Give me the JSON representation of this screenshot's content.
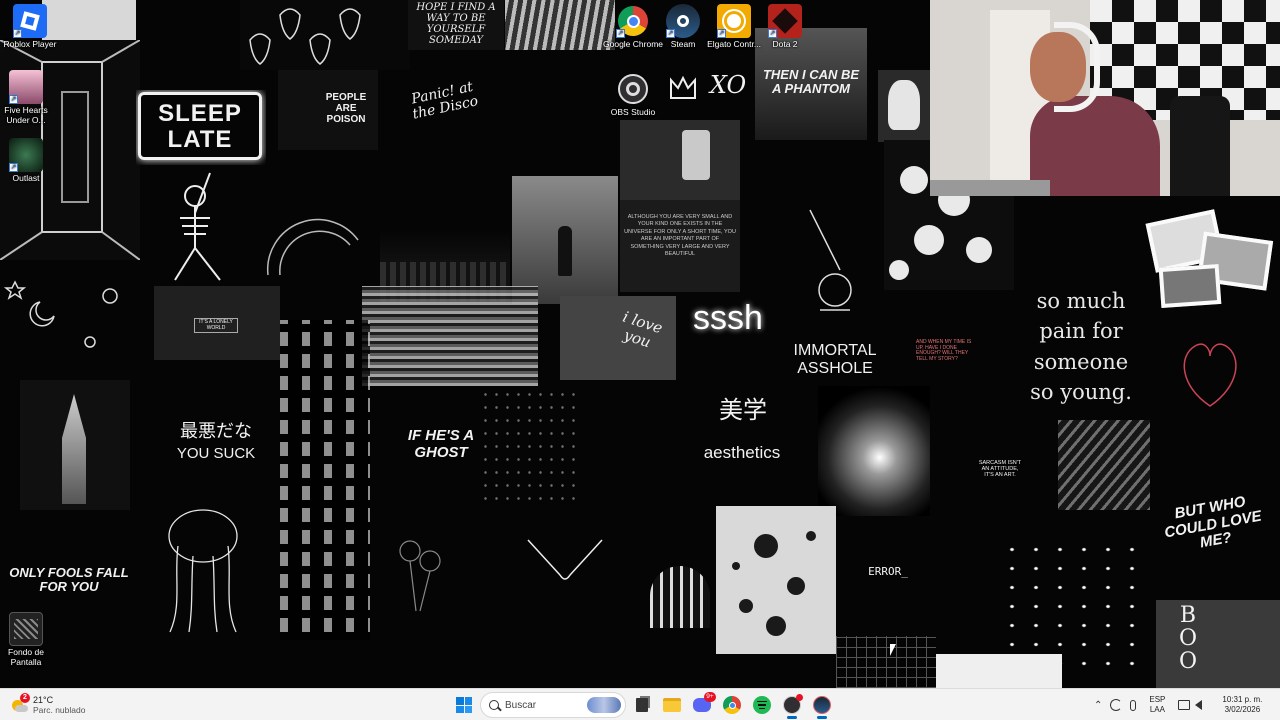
{
  "desktop_icons_left": [
    {
      "name": "roblox-player-shortcut",
      "label": "Roblox Player",
      "icon": "roblox-icon"
    },
    {
      "name": "five-hearts-shortcut",
      "label": "Five Hearts Under O...",
      "icon": "five-hearts-icon"
    },
    {
      "name": "outlast-shortcut",
      "label": "Outlast",
      "icon": "outlast-icon"
    },
    {
      "name": "fondo-de-pantalla-shortcut",
      "label": "Fondo de Pantalla",
      "icon": "wallpaper-icon"
    }
  ],
  "desktop_icons_top": [
    {
      "name": "google-chrome-shortcut",
      "label": "Google Chrome",
      "icon": "chrome-icon"
    },
    {
      "name": "steam-shortcut",
      "label": "Steam",
      "icon": "steam-icon"
    },
    {
      "name": "elgato-shortcut",
      "label": "Elgato Contr...",
      "icon": "elgato-icon"
    },
    {
      "name": "dota2-shortcut",
      "label": "Dota 2",
      "icon": "dota2-icon"
    },
    {
      "name": "obs-studio-shortcut",
      "label": "OBS Studio",
      "icon": "obs-icon"
    }
  ],
  "wallpaper_texts": {
    "sleep_late": "SLEEP LATE",
    "people_poison": "PEOPLE ARE POISON",
    "panic_disco": "Panic! at the Disco",
    "hope": "HOPE I FIND A WAY TO BE YOURSELF SOMEDAY",
    "phantom": "THEN I CAN BE A PHANTOM",
    "sssh": "sssh",
    "i_love_you": "i love you",
    "immortal": "IMMORTAL ASSHOLE",
    "so_much_pain": "so much pain for someone so young.",
    "japanese_suck": "最悪だな",
    "you_suck": "YOU SUCK",
    "ghost": "IF HE'S A GHOST",
    "aesthetics_jp": "美学",
    "aesthetics": "aesthetics",
    "only_fools": "ONLY FOOLS FALL FOR YOU",
    "but_who": "BUT WHO COULD LOVE ME?",
    "error": "ERROR_",
    "sarcasm": "SARCASM ISN'T AN ATTITUDE, IT'S AN ART.",
    "boo": "BOO",
    "xo": "XO",
    "small_note": "ALTHOUGH YOU ARE VERY SMALL AND YOUR KIND ONE EXISTS IN THE UNIVERSE FOR ONLY A SHORT TIME, YOU ARE AN IMPORTANT PART OF SOMETHING VERY LARGE AND VERY BEAUTIFUL",
    "lonely": "IT'S A LONELY WORLD",
    "story": "AND WHEN MY TIME IS UP, HAVE I DONE ENOUGH? WILL THEY TELL MY STORY?"
  },
  "taskbar": {
    "weather_temp": "21°C",
    "weather_desc": "Parc. nublado",
    "weather_badge": "2",
    "search_placeholder": "Buscar",
    "discord_badge": "9+",
    "language_top": "ESP",
    "language_bottom": "LAA",
    "time": "10:31 p. m.",
    "date": "3/02/2026"
  },
  "colors": {
    "taskbar_bg": "#f3f3f3",
    "accent": "#0067c0",
    "spotify": "#1db954",
    "badge_red": "#e81123"
  }
}
